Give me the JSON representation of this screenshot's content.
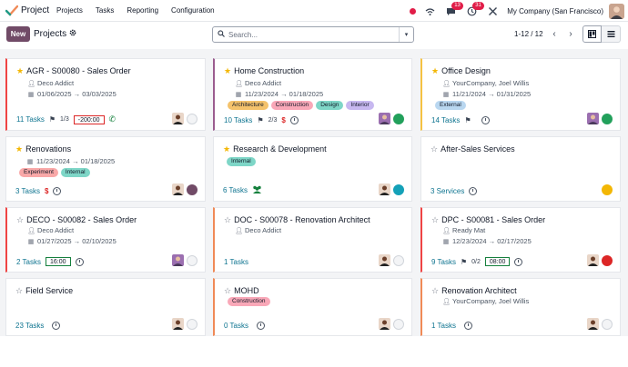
{
  "topbar": {
    "app_name": "Project",
    "menu": [
      "Projects",
      "Tasks",
      "Reporting",
      "Configuration"
    ],
    "chat_count": "13",
    "activity_count": "31",
    "company": "My Company (San Francisco)"
  },
  "control": {
    "new_label": "New",
    "breadcrumb": "Projects",
    "search_placeholder": "Search...",
    "pager": "1-12 / 12"
  },
  "colors": {
    "accent": "#714b67",
    "link": "#0e7490",
    "star": "#f3b705",
    "green_status": "#22a05b",
    "red_status": "#dc2626",
    "yellow_status": "#f3b705",
    "purple_status": "#714b67",
    "teal_status": "#14a1b8"
  },
  "cards": [
    {
      "title": "AGR - S00080 - Sales Order",
      "starred": true,
      "customer": "Deco Addict",
      "dates": "01/06/2025 → 03/03/2025",
      "tags": [],
      "tasks": "11 Tasks",
      "milestone": "1/3",
      "timebox": "-200:00",
      "icons": "phone",
      "status": "none"
    },
    {
      "title": "Home Construction",
      "starred": true,
      "customer": "Deco Addict",
      "dates": "11/23/2024 → 01/18/2025",
      "tags": [
        {
          "name": "Architecture",
          "color": "#f4c26b"
        },
        {
          "name": "Construction",
          "color": "#f9a8b8"
        },
        {
          "name": "Design",
          "color": "#7ed6c7"
        },
        {
          "name": "Interior",
          "color": "#c7b8f0"
        }
      ],
      "tasks": "10 Tasks",
      "milestone": "2/3",
      "timebox": "",
      "icons": "dollar-clock",
      "status": "green"
    },
    {
      "title": "Office Design",
      "starred": true,
      "customer": "YourCompany, Joel Willis",
      "dates": "11/21/2024 → 01/31/2025",
      "tags": [
        {
          "name": "External",
          "color": "#b9d7f0"
        }
      ],
      "tasks": "14 Tasks",
      "milestone": "",
      "timebox": "",
      "icons": "clock",
      "status": "green"
    },
    {
      "title": "Renovations",
      "starred": true,
      "customer": "",
      "dates": "11/23/2024 → 01/18/2025",
      "tags": [
        {
          "name": "Experiment",
          "color": "#f9a8a8"
        },
        {
          "name": "Internal",
          "color": "#7ed6c7"
        }
      ],
      "tasks": "3 Tasks",
      "milestone": "",
      "timebox": "",
      "icons": "dollar-clock",
      "status": "purple"
    },
    {
      "title": "Research & Development",
      "starred": true,
      "customer": "",
      "dates": "",
      "tags": [
        {
          "name": "Internal",
          "color": "#7ed6c7"
        }
      ],
      "tasks": "6 Tasks",
      "milestone": "",
      "timebox": "",
      "icons": "people",
      "status": "teal"
    },
    {
      "title": "After-Sales Services",
      "starred": false,
      "customer": "",
      "dates": "",
      "tags": [],
      "tasks": "3 Services",
      "milestone": "",
      "timebox": "",
      "icons": "clock",
      "status": "yellow"
    },
    {
      "title": "DECO - S00082 - Sales Order",
      "starred": false,
      "customer": "Deco Addict",
      "dates": "01/27/2025 → 02/10/2025",
      "tags": [],
      "tasks": "2 Tasks",
      "milestone": "",
      "timebox": "16:00",
      "icons": "clock",
      "status": "none"
    },
    {
      "title": "DOC - S00078 - Renovation Architect",
      "starred": false,
      "customer": "Deco Addict",
      "dates": "",
      "tags": [],
      "tasks": "1 Tasks",
      "milestone": "",
      "timebox": "",
      "icons": "",
      "status": "none"
    },
    {
      "title": "DPC - S00081 - Sales Order",
      "starred": false,
      "customer": "Ready Mat",
      "dates": "12/23/2024 → 02/17/2025",
      "tags": [],
      "tasks": "9 Tasks",
      "milestone": "0/2",
      "timebox": "08:00",
      "icons": "clock",
      "status": "red"
    },
    {
      "title": "Field Service",
      "starred": false,
      "customer": "",
      "dates": "",
      "tags": [],
      "tasks": "23 Tasks",
      "milestone": "",
      "timebox": "",
      "icons": "clock",
      "status": "none"
    },
    {
      "title": "MOHD",
      "starred": false,
      "customer": "",
      "dates": "",
      "tags": [
        {
          "name": "Construction",
          "color": "#f9a8b8"
        }
      ],
      "tasks": "0 Tasks",
      "milestone": "",
      "timebox": "",
      "icons": "clock",
      "status": "none"
    },
    {
      "title": "Renovation Architect",
      "starred": false,
      "customer": "YourCompany, Joel Willis",
      "dates": "",
      "tags": [],
      "tasks": "1 Tasks",
      "milestone": "",
      "timebox": "",
      "icons": "clock",
      "status": "none"
    }
  ]
}
